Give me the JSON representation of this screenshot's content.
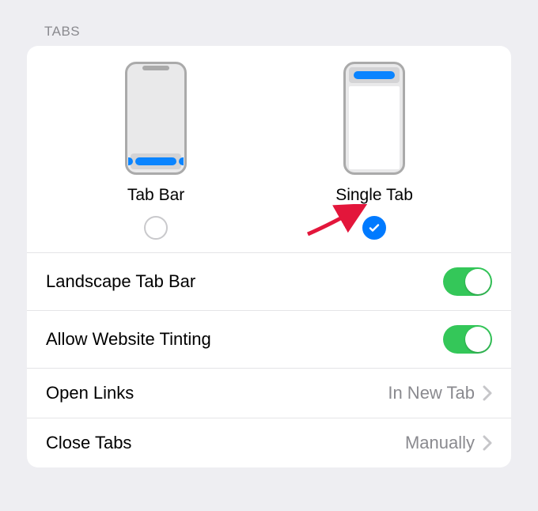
{
  "section": {
    "title": "TABS"
  },
  "layouts": {
    "tabbar": {
      "label": "Tab Bar",
      "selected": false
    },
    "singletab": {
      "label": "Single Tab",
      "selected": true
    }
  },
  "rows": {
    "landscape": {
      "label": "Landscape Tab Bar",
      "on": true
    },
    "tinting": {
      "label": "Allow Website Tinting",
      "on": true
    },
    "openlinks": {
      "label": "Open Links",
      "value": "In New Tab"
    },
    "closetabs": {
      "label": "Close Tabs",
      "value": "Manually"
    }
  }
}
